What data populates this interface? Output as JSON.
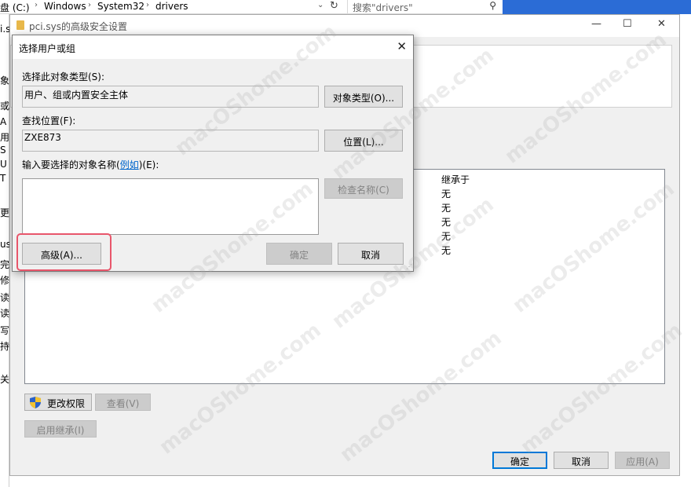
{
  "explorer": {
    "breadcrumb": [
      "盘 (C:)",
      "Windows",
      "System32",
      "drivers"
    ],
    "search_placeholder": "搜索\"drivers\"",
    "left_labels": [
      "i.s",
      "象",
      "或",
      "A",
      "用",
      "S",
      "U",
      "T",
      "更",
      "us",
      "完",
      "修",
      "读",
      "读",
      "写",
      "持",
      "关"
    ]
  },
  "adv_window": {
    "title": "pci.sys的高级安全设置",
    "controls": {
      "minimize": "—",
      "maximize": "☐",
      "close": "✕"
    },
    "permission_list": {
      "inherit_header": "继承于",
      "inherit_values": [
        "无",
        "无",
        "无",
        "无",
        "无"
      ]
    },
    "buttons": {
      "change_permissions": "更改权限",
      "view": "查看(V)",
      "enable_inheritance": "启用继承(I)",
      "ok": "确定",
      "cancel": "取消",
      "apply": "应用(A)"
    }
  },
  "select_dialog": {
    "title": "选择用户或组",
    "close_glyph": "✕",
    "object_type_label": "选择此对象类型(S):",
    "object_type_value": "用户、组或内置安全主体",
    "object_type_button": "对象类型(O)...",
    "location_label": "查找位置(F):",
    "location_value": "ZXE873",
    "location_button": "位置(L)...",
    "names_label_before": "输入要选择的对象名称(",
    "names_label_link": "例如",
    "names_label_after": ")(E):",
    "names_value": "",
    "check_names_button": "检查名称(C)",
    "advanced_button": "高级(A)...",
    "ok_button": "确定",
    "cancel_button": "取消"
  },
  "watermark": "macOShome.com",
  "colors": {
    "highlight": "#e8566b",
    "link": "#0066cc",
    "default_button_border": "#0078d7",
    "desktop_blue": "#2b6cd6"
  }
}
